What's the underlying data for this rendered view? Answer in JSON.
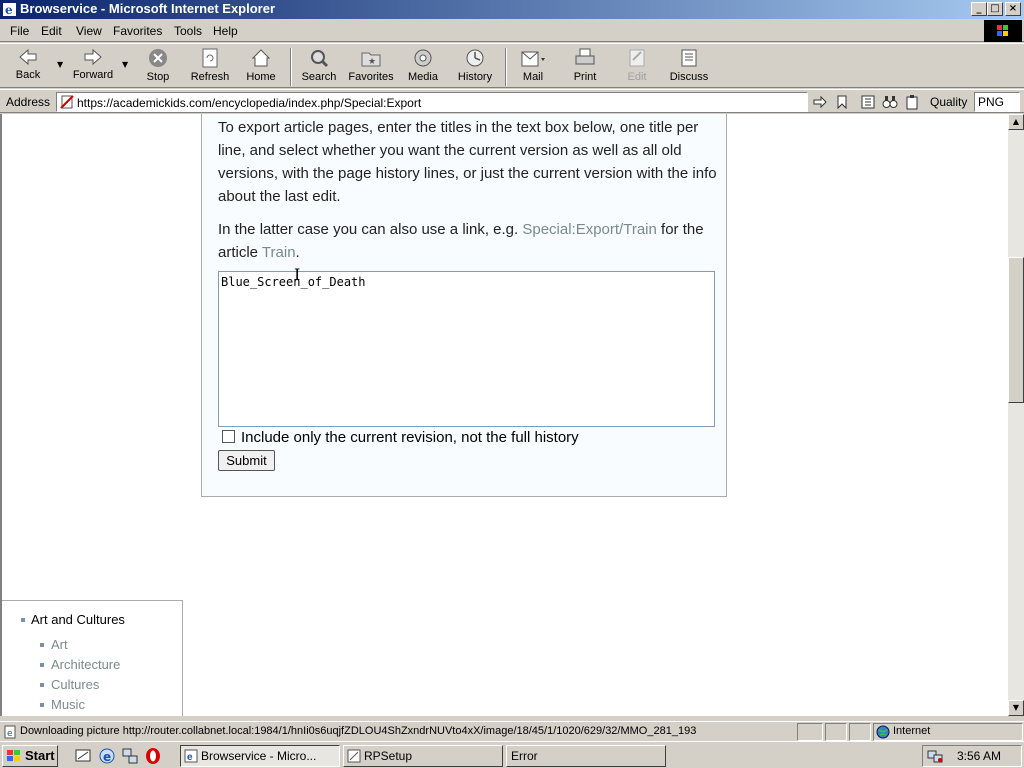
{
  "window": {
    "title": "Browservice - Microsoft Internet Explorer",
    "buttons": {
      "minimize": "_",
      "maximize": "□",
      "close": "×"
    }
  },
  "menu": [
    {
      "label": "File",
      "key": "F"
    },
    {
      "label": "Edit",
      "key": "E"
    },
    {
      "label": "View",
      "key": "V"
    },
    {
      "label": "Favorites",
      "key": "a"
    },
    {
      "label": "Tools",
      "key": "T"
    },
    {
      "label": "Help",
      "key": "H"
    }
  ],
  "toolbar": {
    "back": "Back",
    "forward": "Forward",
    "stop": "Stop",
    "refresh": "Refresh",
    "home": "Home",
    "search": "Search",
    "favorites": "Favorites",
    "media": "Media",
    "history": "History",
    "mail": "Mail",
    "print": "Print",
    "edit": "Edit",
    "discuss": "Discuss"
  },
  "address": {
    "label": "Address",
    "url": "https://academickids.com/encyclopedia/index.php/Special:Export",
    "quality_label": "Quality",
    "quality_value": "PNG"
  },
  "page": {
    "intro": "To export article pages, enter the titles in the text box below, one title per line, and select whether you want the current version as well as all old versions, with the page history lines, or just the current version with the info about the last edit.",
    "latter_prefix": "In the latter case you can also use a link, e.g. ",
    "latter_link": "Special:Export/Train",
    "latter_mid": " for the article ",
    "latter_link2": "Train",
    "latter_suffix": ".",
    "textarea_value": "Blue_Screen_of_Death",
    "checkbox_label": "Include only the current revision, not the full history",
    "submit_label": "Submit"
  },
  "nav": {
    "heading": "Art and Cultures",
    "items": [
      "Art",
      "Architecture",
      "Cultures",
      "Music"
    ]
  },
  "status": {
    "message": "Downloading picture http://router.collabnet.local:1984/1/hnIi0s6uqjfZDLOU4ShZxndrNUVto4xX/image/18/45/1/1020/629/32/MMO_281_193",
    "zone": "Internet"
  },
  "taskbar": {
    "start": "Start",
    "tasks": [
      "Browservice - Micro...",
      "RPSetup",
      "Error"
    ],
    "clock": "3:56 AM"
  },
  "colors": {
    "titlebar": "#0a246a",
    "link": "#7a8a8a",
    "chrome": "#d4d0c8"
  }
}
